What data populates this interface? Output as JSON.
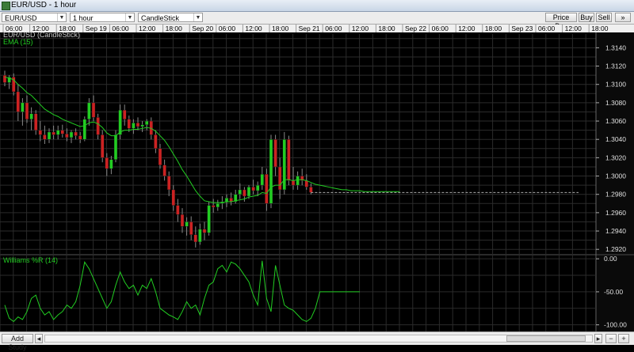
{
  "window": {
    "title": "EUR/USD - 1 hour"
  },
  "toolbar": {
    "symbol": "EUR/USD",
    "interval": "1 hour",
    "chart_type": "CandleStick",
    "price_box_label": "Price Box",
    "buy_label": "Buy",
    "sell_label": "Sell"
  },
  "time_axis": {
    "labels": [
      "06:00",
      "12:00",
      "18:00",
      "Sep 19",
      "06:00",
      "12:00",
      "18:00",
      "Sep 20",
      "06:00",
      "12:00",
      "18:00",
      "Sep 21",
      "06:00",
      "12:00",
      "18:00",
      "Sep 22",
      "06:00",
      "12:00",
      "18:00",
      "Sep 23",
      "06:00",
      "12:00",
      "18:00"
    ]
  },
  "price_panel": {
    "title": "EUR/USD (CandleStick)",
    "indicator": "EMA (15)",
    "ticks": [
      "1.3140",
      "1.3120",
      "1.3100",
      "1.3080",
      "1.3060",
      "1.3040",
      "1.3020",
      "1.3000",
      "1.2980",
      "1.2960",
      "1.2940",
      "1.2920"
    ]
  },
  "williams_panel": {
    "title": "Williams %R (14)",
    "ticks": [
      "0.00",
      "-50.00",
      "-100.00"
    ]
  },
  "colors": {
    "bull": "#22cc22",
    "bear": "#cc2222",
    "ema": "#22cc22",
    "grid": "#2b2b2b",
    "background": "#000000"
  },
  "chart_data": {
    "type": "candlestick",
    "price_ylim": [
      1.2915,
      1.3155
    ],
    "williams_ylim": [
      -110,
      5
    ],
    "candles": [
      [
        1.311,
        1.3115,
        1.3098,
        1.3102
      ],
      [
        1.3102,
        1.311,
        1.3095,
        1.3108
      ],
      [
        1.3108,
        1.3112,
        1.3088,
        1.3092
      ],
      [
        1.3092,
        1.31,
        1.306,
        1.307
      ],
      [
        1.307,
        1.3085,
        1.3055,
        1.308
      ],
      [
        1.308,
        1.3088,
        1.3058,
        1.3062
      ],
      [
        1.3062,
        1.3075,
        1.305,
        1.3068
      ],
      [
        1.3068,
        1.3072,
        1.3045,
        1.305
      ],
      [
        1.305,
        1.306,
        1.3038,
        1.3045
      ],
      [
        1.3045,
        1.3055,
        1.3035,
        1.304
      ],
      [
        1.304,
        1.3052,
        1.3036,
        1.3048
      ],
      [
        1.3048,
        1.3055,
        1.304,
        1.3045
      ],
      [
        1.3045,
        1.3055,
        1.304,
        1.305
      ],
      [
        1.305,
        1.3056,
        1.3042,
        1.3046
      ],
      [
        1.3046,
        1.3052,
        1.3038,
        1.3042
      ],
      [
        1.3042,
        1.305,
        1.3036,
        1.3048
      ],
      [
        1.3048,
        1.3052,
        1.304,
        1.3044
      ],
      [
        1.3044,
        1.3048,
        1.3036,
        1.304
      ],
      [
        1.304,
        1.3065,
        1.3038,
        1.3062
      ],
      [
        1.3062,
        1.3085,
        1.3055,
        1.308
      ],
      [
        1.308,
        1.3088,
        1.306,
        1.3064
      ],
      [
        1.3064,
        1.3068,
        1.304,
        1.3045
      ],
      [
        1.3045,
        1.305,
        1.3015,
        1.302
      ],
      [
        1.302,
        1.3025,
        1.3,
        1.3008
      ],
      [
        1.3008,
        1.3022,
        1.3002,
        1.3018
      ],
      [
        1.3018,
        1.305,
        1.3015,
        1.3045
      ],
      [
        1.3045,
        1.3078,
        1.304,
        1.3072
      ],
      [
        1.3072,
        1.3078,
        1.3055,
        1.3062
      ],
      [
        1.3062,
        1.3066,
        1.3048,
        1.3052
      ],
      [
        1.3052,
        1.3062,
        1.3046,
        1.3058
      ],
      [
        1.3058,
        1.3064,
        1.305,
        1.3054
      ],
      [
        1.3054,
        1.306,
        1.3048,
        1.3056
      ],
      [
        1.3056,
        1.3062,
        1.305,
        1.306
      ],
      [
        1.306,
        1.3064,
        1.304,
        1.3045
      ],
      [
        1.3045,
        1.305,
        1.3025,
        1.303
      ],
      [
        1.303,
        1.3035,
        1.3008,
        1.3012
      ],
      [
        1.3012,
        1.3018,
        1.2995,
        1.3
      ],
      [
        1.3,
        1.3005,
        1.2978,
        1.2985
      ],
      [
        1.2985,
        1.299,
        1.2962,
        1.2968
      ],
      [
        1.2968,
        1.2975,
        1.295,
        1.2958
      ],
      [
        1.2958,
        1.2965,
        1.2938,
        1.2945
      ],
      [
        1.2945,
        1.2955,
        1.2935,
        1.295
      ],
      [
        1.295,
        1.2956,
        1.293,
        1.2936
      ],
      [
        1.2936,
        1.2945,
        1.2922,
        1.2928
      ],
      [
        1.2928,
        1.2948,
        1.2925,
        1.2942
      ],
      [
        1.2942,
        1.295,
        1.293,
        1.2938
      ],
      [
        1.2938,
        1.2972,
        1.2935,
        1.2968
      ],
      [
        1.2968,
        1.2975,
        1.296,
        1.2966
      ],
      [
        1.2966,
        1.2974,
        1.2962,
        1.297
      ],
      [
        1.297,
        1.2978,
        1.2964,
        1.2972
      ],
      [
        1.2972,
        1.298,
        1.2966,
        1.2976
      ],
      [
        1.2976,
        1.2982,
        1.2968,
        1.2972
      ],
      [
        1.2972,
        1.2985,
        1.297,
        1.298
      ],
      [
        1.298,
        1.2992,
        1.2975,
        1.2985
      ],
      [
        1.2985,
        1.2988,
        1.2972,
        1.2978
      ],
      [
        1.2978,
        1.299,
        1.2975,
        1.2988
      ],
      [
        1.2988,
        1.2996,
        1.298,
        1.2984
      ],
      [
        1.2984,
        1.2994,
        1.2978,
        1.299
      ],
      [
        1.299,
        1.301,
        1.2985,
        1.3002
      ],
      [
        1.3002,
        1.3008,
        1.2962,
        1.297
      ],
      [
        1.297,
        1.3045,
        1.2965,
        1.304
      ],
      [
        1.304,
        1.3045,
        1.3,
        1.301
      ],
      [
        1.301,
        1.302,
        1.2975,
        1.2985
      ],
      [
        1.2985,
        1.3048,
        1.298,
        1.304
      ],
      [
        1.304,
        1.3044,
        1.299,
        1.2995
      ],
      [
        1.2995,
        1.301,
        1.2985,
        1.299
      ],
      [
        1.299,
        1.3005,
        1.2985,
        1.3
      ],
      [
        1.3,
        1.3008,
        1.299,
        1.2995
      ],
      [
        1.2995,
        1.3002,
        1.2985,
        1.2988
      ],
      [
        1.2988,
        1.2992,
        1.298,
        1.2982
      ]
    ],
    "ema": [
      1.3108,
      1.3107,
      1.3105,
      1.31,
      1.3096,
      1.3091,
      1.3088,
      1.3083,
      1.3078,
      1.3073,
      1.307,
      1.3067,
      1.3065,
      1.3062,
      1.306,
      1.3058,
      1.3056,
      1.3054,
      1.3055,
      1.3058,
      1.3059,
      1.3057,
      1.3053,
      1.3047,
      1.3044,
      1.3044,
      1.3048,
      1.305,
      1.305,
      1.3051,
      1.3051,
      1.3052,
      1.3053,
      1.3052,
      1.3049,
      1.3044,
      1.3039,
      1.3032,
      1.3024,
      1.3016,
      1.3007,
      1.3,
      1.2992,
      1.2984,
      1.2978,
      1.2973,
      1.2972,
      1.2971,
      1.2971,
      1.2971,
      1.2972,
      1.2972,
      1.2973,
      1.2974,
      1.2975,
      1.2977,
      1.2978,
      1.2979,
      1.2982,
      1.2981,
      1.2988,
      1.299,
      1.299,
      1.2996,
      1.2996,
      1.2995,
      1.2996,
      1.2996,
      1.2995,
      1.2993,
      1.2991,
      1.299,
      1.2989,
      1.2988,
      1.2987,
      1.2986,
      1.2985,
      1.2985,
      1.2984,
      1.2984,
      1.2984,
      1.2983,
      1.2983,
      1.2983,
      1.2983,
      1.2983,
      1.2983,
      1.2983,
      1.2983,
      1.2983
    ],
    "last_price": 1.2982,
    "williams_r": [
      -70,
      -90,
      -95,
      -88,
      -92,
      -80,
      -60,
      -55,
      -75,
      -85,
      -80,
      -92,
      -85,
      -80,
      -70,
      -75,
      -65,
      -40,
      -5,
      -15,
      -30,
      -45,
      -60,
      -75,
      -65,
      -40,
      -20,
      -35,
      -45,
      -40,
      -55,
      -40,
      -45,
      -30,
      -50,
      -75,
      -80,
      -85,
      -88,
      -92,
      -80,
      -65,
      -75,
      -70,
      -85,
      -60,
      -40,
      -35,
      -15,
      -10,
      -20,
      -5,
      -8,
      -15,
      -25,
      -35,
      -55,
      -70,
      -3,
      -60,
      -80,
      -10,
      -40,
      -70,
      -75,
      -78,
      -85,
      -92,
      -95,
      -90,
      -75,
      -50,
      -50,
      -50,
      -50,
      -50,
      -50,
      -50,
      -50,
      -50,
      -50
    ]
  }
}
